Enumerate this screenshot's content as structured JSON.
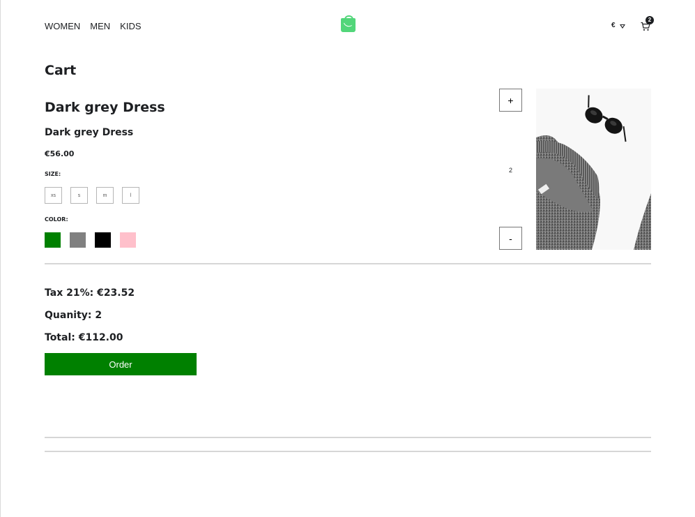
{
  "header": {
    "nav": [
      {
        "label": "WOMEN"
      },
      {
        "label": "MEN"
      },
      {
        "label": "KIDS"
      }
    ],
    "currency": {
      "symbol": "€"
    },
    "cart": {
      "count": "2"
    }
  },
  "page": {
    "title": "Cart"
  },
  "item": {
    "brand": "Dark grey Dress",
    "name": "Dark grey Dress",
    "price": "€56.00",
    "size_label": "SIZE:",
    "sizes": [
      "xs",
      "s",
      "m",
      "l"
    ],
    "color_label": "COLOR:",
    "colors": [
      {
        "name": "green",
        "hex": "#008000"
      },
      {
        "name": "grey",
        "hex": "#808080"
      },
      {
        "name": "black",
        "hex": "#000000"
      },
      {
        "name": "pink",
        "hex": "#ffc0cb"
      }
    ],
    "quantity": "2",
    "increment_label": "+",
    "decrement_label": "-"
  },
  "summary": {
    "tax": "Tax 21%: €23.52",
    "quantity": "Quanity: 2",
    "total": "Total: €112.00",
    "order_label": "Order"
  },
  "colors": {
    "accent": "#52d67a",
    "order_button": "#008000",
    "text": "#1d1f22"
  }
}
